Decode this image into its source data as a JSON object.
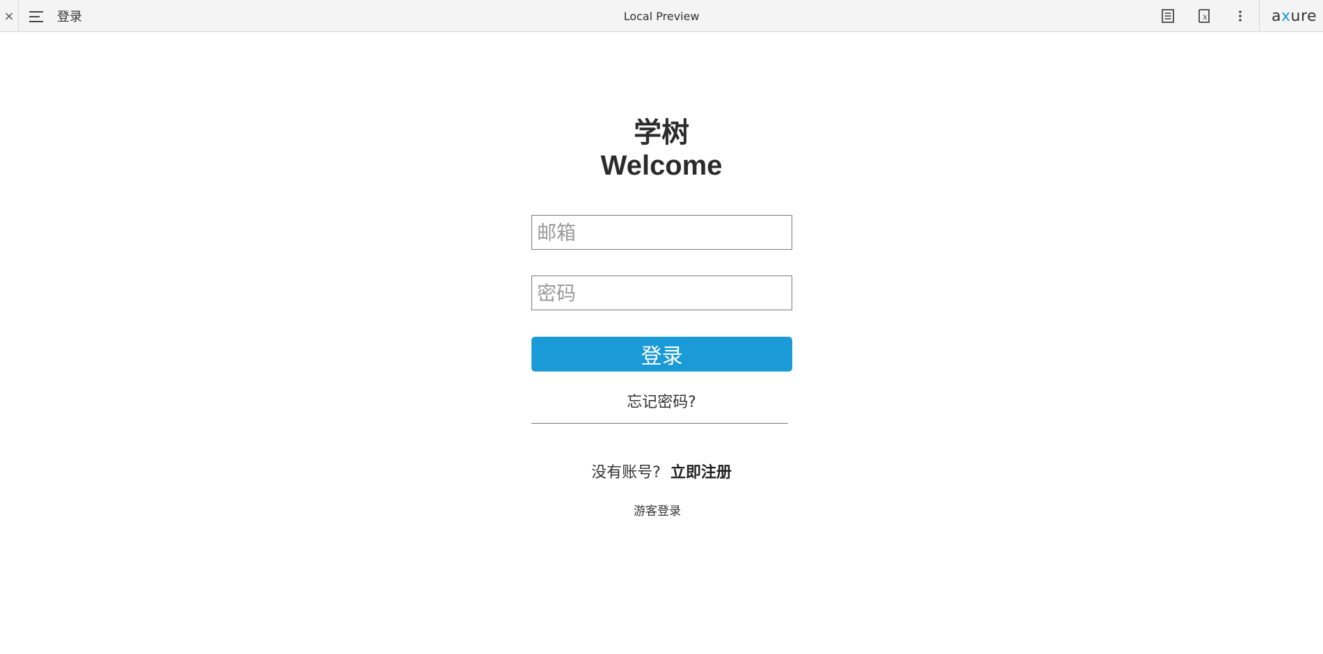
{
  "toolbar": {
    "close_glyph": "×",
    "page_name": "登录",
    "title": "Local Preview",
    "logo_prefix": "a",
    "logo_x": "x",
    "logo_suffix": "ure",
    "icons": [
      "close-icon",
      "menu-icon",
      "notes-icon",
      "variables-icon",
      "more-vertical-icon"
    ]
  },
  "login": {
    "title_cn": "学树",
    "title_en": "Welcome",
    "email_placeholder": "邮箱",
    "password_placeholder": "密码",
    "login_button": "登录",
    "forgot_password": "忘记密码?",
    "no_account": "没有账号?",
    "register_now": "立即注册",
    "guest_login": "游客登录"
  },
  "colors": {
    "accent": "#1a9bd7",
    "text": "#333333",
    "border": "#797979",
    "toolbar_bg": "#f4f4f4"
  }
}
